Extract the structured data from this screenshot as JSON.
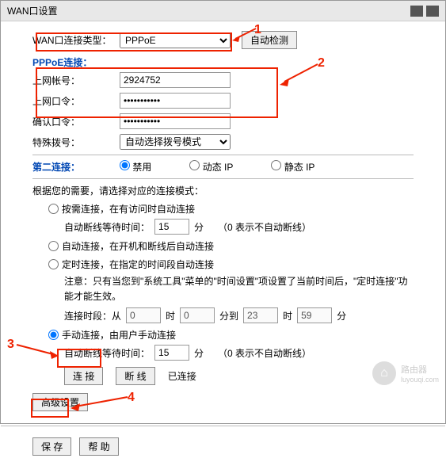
{
  "titlebar": {
    "title": "WAN口设置"
  },
  "wan": {
    "type_label": "WAN口连接类型：",
    "type_value": "PPPoE",
    "auto_detect": "自动检测"
  },
  "pppoe": {
    "section": "PPPoE连接：",
    "account_label": "上网帐号：",
    "account_value": "2924752",
    "password_label": "上网口令：",
    "password_value": "•••••••••••",
    "confirm_label": "确认口令：",
    "confirm_value": "•••••••••••",
    "dial_label": "特殊拨号：",
    "dial_value": "自动选择拨号模式"
  },
  "second": {
    "label": "第二连接：",
    "opt_disable": "禁用",
    "opt_dyn": "动态 IP",
    "opt_static": "静态 IP"
  },
  "mode": {
    "intro": "根据您的需要，请选择对应的连接模式：",
    "ondemand": "按需连接，在有访问时自动连接",
    "auto_disc_label": "自动断线等待时间：",
    "auto_disc_val": "15",
    "unit_min": "分",
    "hint_disc": "（0 表示不自动断线）",
    "auto": "自动连接，在开机和断线后自动连接",
    "timed": "定时连接，在指定的时间段自动连接",
    "note": "注意：只有当您到\"系统工具\"菜单的\"时间设置\"项设置了当前时间后，\"定时连接\"功能才能生效。",
    "period_label": "连接时段：从",
    "period_from_h": "0",
    "unit_h": "时",
    "period_from_m": "0",
    "unit_m": "分到",
    "period_to_h": "23",
    "period_to_m": "59",
    "unit_min2": "分",
    "manual": "手动连接，由用户手动连接",
    "auto_disc_val2": "15"
  },
  "buttons": {
    "connect": "连 接",
    "disconnect": "断 线",
    "status": "已连接",
    "advanced": "高级设置",
    "save": "保 存",
    "help": "帮 助"
  },
  "anno": {
    "a1": "1",
    "a2": "2",
    "a3": "3",
    "a4": "4"
  },
  "watermark": {
    "text": "路由器",
    "sub": "luyouqi.com"
  }
}
